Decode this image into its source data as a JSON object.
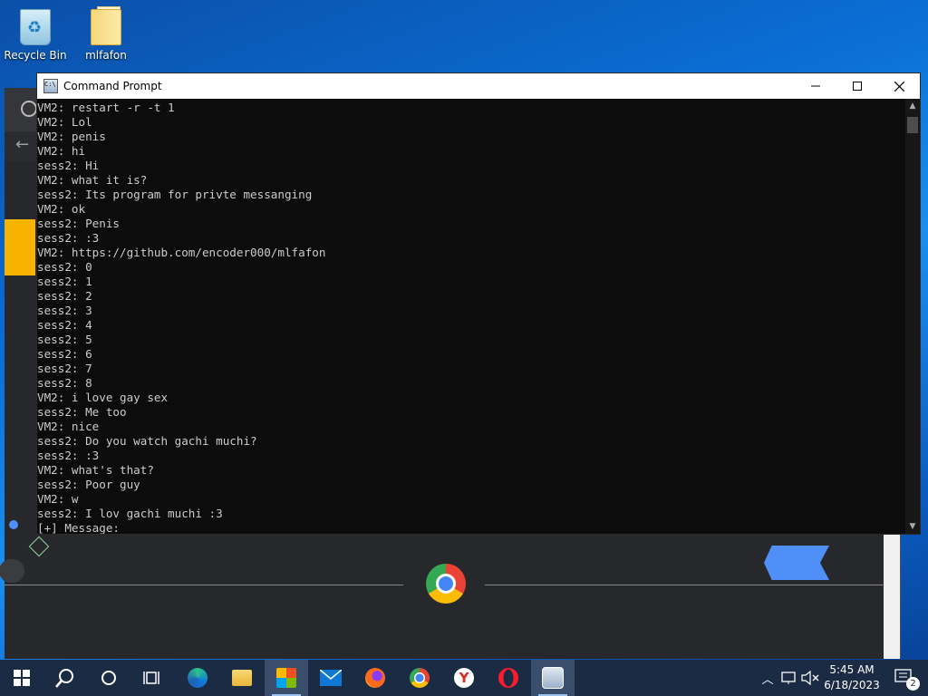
{
  "desktop": {
    "icons": [
      {
        "label": "Recycle Bin",
        "icon": "recycle-bin-icon"
      },
      {
        "label": "mlfafon",
        "icon": "folder-icon"
      }
    ]
  },
  "console": {
    "title": "Command Prompt",
    "lines": [
      "VM2: restart -r -t 1",
      "VM2: Lol",
      "VM2: penis",
      "VM2: hi",
      "sess2: Hi",
      "VM2: what it is?",
      "sess2: Its program for privte messanging",
      "VM2: ok",
      "sess2: Penis",
      "sess2: :3",
      "VM2: https://github.com/encoder000/mlfafon",
      "sess2: 0",
      "sess2: 1",
      "sess2: 2",
      "sess2: 3",
      "sess2: 4",
      "sess2: 5",
      "sess2: 6",
      "sess2: 7",
      "sess2: 8",
      "VM2: i love gay sex",
      "sess2: Me too",
      "VM2: nice",
      "sess2: Do you watch gachi muchi?",
      "sess2: :3",
      "VM2: what's that?",
      "sess2: Poor guy",
      "VM2: w",
      "sess2: I lov gachi muchi :3",
      "[+] Message:"
    ]
  },
  "taskbar": {
    "items": [
      {
        "name": "start-button",
        "icon": "windows-logo-icon"
      },
      {
        "name": "search-button",
        "icon": "search-icon"
      },
      {
        "name": "cortana-button",
        "icon": "circle-icon"
      },
      {
        "name": "task-view-button",
        "icon": "task-view-icon"
      },
      {
        "name": "edge-button",
        "icon": "edge-icon"
      },
      {
        "name": "file-explorer-button",
        "icon": "folder-icon"
      },
      {
        "name": "store-button",
        "icon": "store-icon"
      },
      {
        "name": "mail-button",
        "icon": "mail-icon"
      },
      {
        "name": "firefox-button",
        "icon": "firefox-icon"
      },
      {
        "name": "chrome-button",
        "icon": "chrome-icon"
      },
      {
        "name": "yandex-button",
        "icon": "yandex-icon"
      },
      {
        "name": "opera-button",
        "icon": "opera-icon"
      },
      {
        "name": "command-prompt-taskbar-button",
        "icon": "command-prompt-icon"
      }
    ],
    "time": "5:45 AM",
    "date": "6/18/2023",
    "notification_count": "2"
  },
  "colors": {
    "console_bg": "#0c0c0c",
    "console_text": "#cccccc",
    "taskbar_bg": "#1b2b44",
    "accent": "#4f8ff7"
  }
}
